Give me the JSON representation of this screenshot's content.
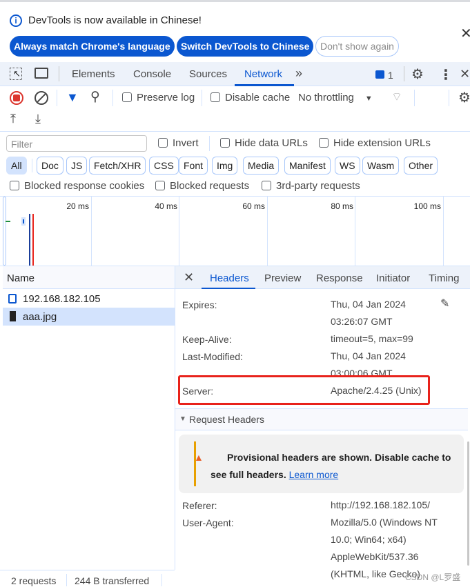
{
  "banner": {
    "message": "DevTools is now available in Chinese!",
    "buttons": [
      "Always match Chrome's language",
      "Switch DevTools to Chinese",
      "Don't show again"
    ]
  },
  "nav": {
    "tabs": [
      "Elements",
      "Console",
      "Sources",
      "Network"
    ],
    "active": "Network",
    "issues_count": "1"
  },
  "toolbar": {
    "preserve_log": "Preserve log",
    "disable_cache": "Disable cache",
    "throttling": "No throttling"
  },
  "filter": {
    "placeholder": "Filter",
    "invert": "Invert",
    "hide_data_urls": "Hide data URLs",
    "hide_extension_urls": "Hide extension URLs",
    "types": [
      "All",
      "Doc",
      "JS",
      "Fetch/XHR",
      "CSS",
      "Font",
      "Img",
      "Media",
      "Manifest",
      "WS",
      "Wasm",
      "Other"
    ],
    "active_type": "All",
    "blocked_cookies": "Blocked response cookies",
    "blocked_requests": "Blocked requests",
    "third_party": "3rd-party requests"
  },
  "timeline": {
    "ticks": [
      "20 ms",
      "40 ms",
      "60 ms",
      "80 ms",
      "100 ms"
    ]
  },
  "requests": {
    "header": "Name",
    "items": [
      "192.168.182.105",
      "aaa.jpg"
    ],
    "selected": "aaa.jpg"
  },
  "details": {
    "tabs": [
      "Headers",
      "Preview",
      "Response",
      "Initiator",
      "Timing"
    ],
    "active": "Headers",
    "response_headers": [
      {
        "key": "Expires:",
        "value": [
          "Thu, 04 Jan 2024",
          "03:26:07 GMT"
        ]
      },
      {
        "key": "Keep-Alive:",
        "value": [
          "timeout=5, max=99"
        ]
      },
      {
        "key": "Last-Modified:",
        "value": [
          "Thu, 04 Jan 2024",
          "03:00:06 GMT"
        ]
      },
      {
        "key": "Server:",
        "value": [
          "Apache/2.4.25 (Unix)"
        ]
      }
    ],
    "request_section": "Request Headers",
    "warning": "Provisional headers are shown. Disable cache to see full headers.",
    "learn_more": "Learn more",
    "request_headers": [
      {
        "key": "Referer:",
        "value": [
          "http://192.168.182.105/"
        ]
      },
      {
        "key": "User-Agent:",
        "value": [
          "Mozilla/5.0 (Windows NT",
          "10.0; Win64; x64)",
          "AppleWebKit/537.36",
          "(KHTML, like Gecko)"
        ]
      }
    ]
  },
  "status": {
    "requests": "2 requests",
    "transferred": "244 B transferred"
  },
  "watermark": "CSDN @L罗盛",
  "colors": {
    "accent": "#0b57d0",
    "highlight": "#e8221b",
    "warning": "#e37400"
  }
}
